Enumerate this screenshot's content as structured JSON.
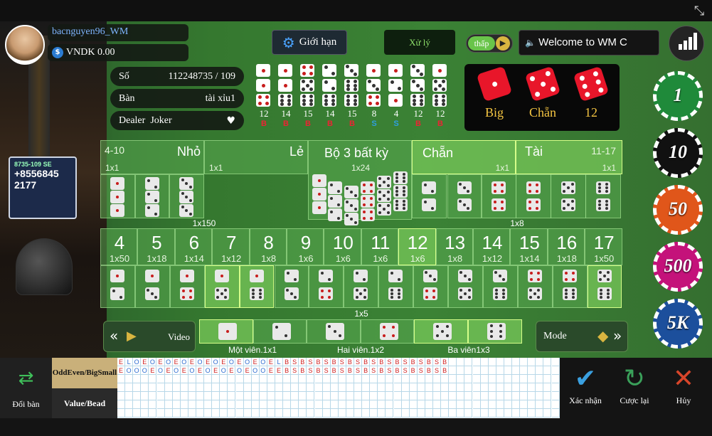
{
  "user": {
    "name": "bacnguyen96_WM",
    "balance": "VNDK 0.00"
  },
  "video_overlay": {
    "line1": "8735-109",
    "line2": "SE",
    "line3": "+8556845",
    "line4": "2177"
  },
  "info": {
    "so_label": "Số",
    "so_value": "112248735 / 109",
    "ban_label": "Bàn",
    "ban_value": "tài xỉu1",
    "dealer_label": "Dealer",
    "dealer_value": "Joker"
  },
  "top": {
    "limit_label": "Giới hạn",
    "status": "Xử lý",
    "quality": "thấp",
    "marquee": "Welcome to WM C"
  },
  "history": [
    {
      "d": [
        1,
        1,
        4
      ],
      "total": "12",
      "r": "B"
    },
    {
      "d": [
        1,
        1,
        6
      ],
      "total": "14",
      "r": "B"
    },
    {
      "d": [
        4,
        5,
        6
      ],
      "total": "15",
      "r": "B"
    },
    {
      "d": [
        2,
        2,
        6
      ],
      "total": "14",
      "r": "B"
    },
    {
      "d": [
        3,
        6,
        6
      ],
      "total": "15",
      "r": "B"
    },
    {
      "d": [
        1,
        3,
        4
      ],
      "total": "8",
      "r": "S"
    },
    {
      "d": [
        1,
        2,
        1
      ],
      "total": "4",
      "r": "S"
    },
    {
      "d": [
        3,
        3,
        6
      ],
      "total": "12",
      "r": "B"
    },
    {
      "d": [
        1,
        5,
        6
      ],
      "total": "12",
      "r": "B"
    }
  ],
  "result": {
    "labels": [
      "Big",
      "Chẵn",
      "12"
    ]
  },
  "board": {
    "small": {
      "range": "4-10",
      "label": "Nhỏ",
      "odds": "1x1"
    },
    "odd": {
      "label": "Lẻ",
      "odds": "1x1"
    },
    "triple": {
      "label": "Bộ 3 bất kỳ",
      "odds": "1x24"
    },
    "even": {
      "label": "Chẵn",
      "odds": "1x1"
    },
    "big": {
      "label": "Tài",
      "range": "11-17",
      "odds": "1x1"
    },
    "triple_specific_odds": "1x150",
    "double_odds": "1x8",
    "totals": [
      {
        "n": "4",
        "o": "1x50"
      },
      {
        "n": "5",
        "o": "1x18"
      },
      {
        "n": "6",
        "o": "1x14"
      },
      {
        "n": "7",
        "o": "1x12"
      },
      {
        "n": "8",
        "o": "1x8"
      },
      {
        "n": "9",
        "o": "1x6"
      },
      {
        "n": "10",
        "o": "1x6"
      },
      {
        "n": "11",
        "o": "1x6"
      },
      {
        "n": "12",
        "o": "1x6"
      },
      {
        "n": "13",
        "o": "1x8"
      },
      {
        "n": "14",
        "o": "1x12"
      },
      {
        "n": "15",
        "o": "1x14"
      },
      {
        "n": "16",
        "o": "1x18"
      },
      {
        "n": "17",
        "o": "1x50"
      }
    ],
    "combo_odds": "1x5",
    "single": {
      "labels": [
        "Một viên.1x1",
        "Hai viên.1x2",
        "Ba viên1x3"
      ]
    }
  },
  "controls": {
    "video": "Video",
    "mode": "Mode"
  },
  "chips": [
    "1",
    "10",
    "50",
    "500",
    "5K"
  ],
  "chip_colors": [
    "#1f8a3a",
    "#111111",
    "#e0561a",
    "#c4127a",
    "#1c4f9c"
  ],
  "stats": {
    "doiban": "Đổi bàn",
    "tab_oddeven": "OddEven/BigSmall",
    "tab_value": "Value/Bead",
    "row1": "ELOEOEOEOEOEOEOEOEOELBSBSBSBSBSBSBSBSBSBSB",
    "row2": "EOOOEOEOEOEOEOEOEOOEEBSBSBSBSBSBSBSBSBSBSB"
  },
  "actions": {
    "confirm": "Xác nhận",
    "redo": "Cược lại",
    "cancel": "Hủy"
  },
  "colors": {
    "red": "#e8162a",
    "gold": "#f5c542",
    "felt": "#3b8235",
    "blue": "#2f9fe0"
  }
}
